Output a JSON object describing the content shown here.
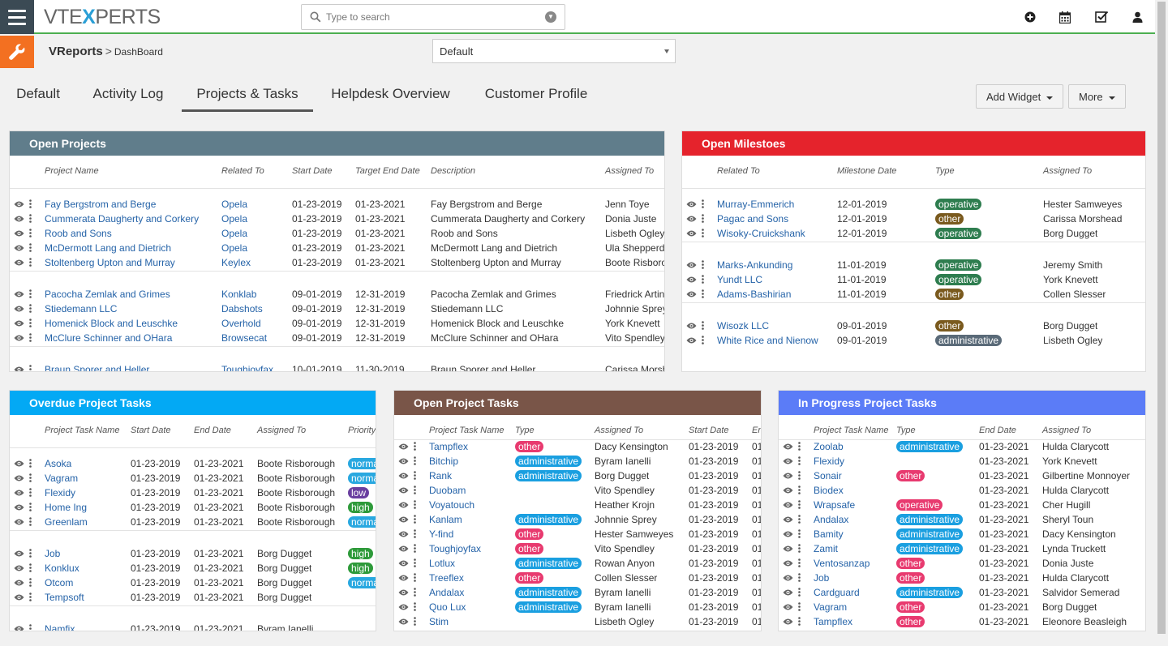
{
  "app": {
    "logo_left": "VTE",
    "logo_x": "X",
    "logo_right": "PERTS"
  },
  "search": {
    "placeholder": "Type to search"
  },
  "top_icons": [
    "plus-circle-icon",
    "calendar-icon",
    "checkbox-icon",
    "user-icon"
  ],
  "breadcrumb": {
    "main": "VReports",
    "sep": ">",
    "sub": "DashBoard"
  },
  "view_select": {
    "value": "Default"
  },
  "tabs": [
    {
      "label": "Default"
    },
    {
      "label": "Activity Log"
    },
    {
      "label": "Projects & Tasks"
    },
    {
      "label": "Helpdesk Overview"
    },
    {
      "label": "Customer Profile"
    }
  ],
  "buttons": {
    "add_widget": "Add Widget",
    "more": "More"
  },
  "colors": {
    "operative": "#2e7d4f",
    "other_brown": "#7a5a1e",
    "administrative_gray": "#5a6a78",
    "normal": "#29a8e0",
    "low": "#6a3fa0",
    "high": "#2e9a3a",
    "other_pink": "#e83a6f",
    "admin_blue": "#1a9fe0",
    "operative_pink": "#e83a6f"
  },
  "open_projects": {
    "title": "Open Projects",
    "columns": [
      "Project Name",
      "Related To",
      "Start Date",
      "Target End Date",
      "Description",
      "Assigned To"
    ],
    "groups": [
      [
        [
          "Fay Bergstrom and Berge",
          "Opela",
          "01-23-2019",
          "01-23-2021",
          "Fay Bergstrom and Berge",
          "Jenn Toye"
        ],
        [
          "Cummerata Daugherty and Corkery",
          "Opela",
          "01-23-2019",
          "01-23-2021",
          "Cummerata Daugherty and Corkery",
          "Donia Juste"
        ],
        [
          "Roob and Sons",
          "Opela",
          "01-23-2019",
          "01-23-2021",
          "Roob and Sons",
          "Lisbeth Ogley"
        ],
        [
          "McDermott Lang and Dietrich",
          "Opela",
          "01-23-2019",
          "01-23-2021",
          "McDermott Lang and Dietrich",
          "Ula Shepperd"
        ],
        [
          "Stoltenberg Upton and Murray",
          "Keylex",
          "01-23-2019",
          "01-23-2021",
          "Stoltenberg Upton and Murray",
          "Boote Risborough"
        ]
      ],
      [
        [
          "Pacocha Zemlak and Grimes",
          "Konklab",
          "09-01-2019",
          "12-31-2019",
          "Pacocha Zemlak and Grimes",
          "Friedrick Artin"
        ],
        [
          "Stiedemann LLC",
          "Dabshots",
          "09-01-2019",
          "12-31-2019",
          "Stiedemann LLC",
          "Johnnie Sprey"
        ],
        [
          "Homenick Block and Leuschke",
          "Overhold",
          "09-01-2019",
          "12-31-2019",
          "Homenick Block and Leuschke",
          "York Knevett"
        ],
        [
          "McClure Schinner and OHara",
          "Browsecat",
          "09-01-2019",
          "12-31-2019",
          "McClure Schinner and OHara",
          "Vito Spendley"
        ]
      ],
      [
        [
          "Braun Sporer and Heller",
          "Toughjoyfax",
          "10-01-2019",
          "11-30-2019",
          "Braun Sporer and Heller",
          "Carissa Morshead"
        ]
      ]
    ]
  },
  "open_milestones": {
    "title": "Open Milestoes",
    "columns": [
      "Related To",
      "Milestone Date",
      "Type",
      "Assigned To"
    ],
    "groups": [
      [
        [
          "Murray-Emmerich",
          "12-01-2019",
          "operative",
          "Hester Samweyes"
        ],
        [
          "Pagac and Sons",
          "12-01-2019",
          "other",
          "Carissa Morshead"
        ],
        [
          "Wisoky-Cruickshank",
          "12-01-2019",
          "operative",
          "Borg Dugget"
        ]
      ],
      [
        [
          "Marks-Ankunding",
          "11-01-2019",
          "operative",
          "Jeremy Smith"
        ],
        [
          "Yundt LLC",
          "11-01-2019",
          "operative",
          "York Knevett"
        ],
        [
          "Adams-Bashirian",
          "11-01-2019",
          "other",
          "Collen Slesser"
        ]
      ],
      [
        [
          "Wisozk LLC",
          "09-01-2019",
          "other",
          "Borg Dugget"
        ],
        [
          "White Rice and Nienow",
          "09-01-2019",
          "administrative",
          "Lisbeth Ogley"
        ]
      ]
    ]
  },
  "overdue_tasks": {
    "title": "Overdue Project Tasks",
    "columns": [
      "Project Task Name",
      "Start Date",
      "End Date",
      "Assigned To",
      "Priority"
    ],
    "groups": [
      [
        [
          "Asoka",
          "01-23-2019",
          "01-23-2021",
          "Boote Risborough",
          "normal"
        ],
        [
          "Vagram",
          "01-23-2019",
          "01-23-2021",
          "Boote Risborough",
          "normal"
        ],
        [
          "Flexidy",
          "01-23-2019",
          "01-23-2021",
          "Boote Risborough",
          "low"
        ],
        [
          "Home Ing",
          "01-23-2019",
          "01-23-2021",
          "Boote Risborough",
          "high"
        ],
        [
          "Greenlam",
          "01-23-2019",
          "01-23-2021",
          "Boote Risborough",
          "normal"
        ]
      ],
      [
        [
          "Job",
          "01-23-2019",
          "01-23-2021",
          "Borg Dugget",
          "high"
        ],
        [
          "Konklux",
          "01-23-2019",
          "01-23-2021",
          "Borg Dugget",
          "high"
        ],
        [
          "Otcom",
          "01-23-2019",
          "01-23-2021",
          "Borg Dugget",
          "normal"
        ],
        [
          "Tempsoft",
          "01-23-2019",
          "01-23-2021",
          "Borg Dugget",
          ""
        ]
      ],
      [
        [
          "Namfix",
          "01-23-2019",
          "01-23-2021",
          "Byram Ianelli",
          ""
        ]
      ]
    ]
  },
  "open_tasks": {
    "title": "Open Project Tasks",
    "columns": [
      "Project Task Name",
      "Type",
      "Assigned To",
      "Start Date",
      "End Date"
    ],
    "rows": [
      [
        "Tampflex",
        "other",
        "Dacy Kensington",
        "01-23-2019",
        "01"
      ],
      [
        "Bitchip",
        "administrative",
        "Byram Ianelli",
        "01-23-2019",
        "01"
      ],
      [
        "Rank",
        "administrative",
        "Borg Dugget",
        "01-23-2019",
        "01"
      ],
      [
        "Duobam",
        "",
        "Vito Spendley",
        "01-23-2019",
        "01"
      ],
      [
        "Voyatouch",
        "",
        "Heather Krojn",
        "01-23-2019",
        "01"
      ],
      [
        "Kanlam",
        "administrative",
        "Johnnie Sprey",
        "01-23-2019",
        "01"
      ],
      [
        "Y-find",
        "other",
        "Hester Samweyes",
        "01-23-2019",
        "01"
      ],
      [
        "Toughjoyfax",
        "other",
        "Vito Spendley",
        "01-23-2019",
        "01"
      ],
      [
        "Lotlux",
        "administrative",
        "Rowan Anyon",
        "01-23-2019",
        "01"
      ],
      [
        "Treeflex",
        "other",
        "Collen Slesser",
        "01-23-2019",
        "01"
      ],
      [
        "Andalax",
        "administrative",
        "Byram Ianelli",
        "01-23-2019",
        "01"
      ],
      [
        "Quo Lux",
        "administrative",
        "Byram Ianelli",
        "01-23-2019",
        "01"
      ],
      [
        "Stim",
        "",
        "Lisbeth Ogley",
        "01-23-2019",
        "01"
      ]
    ]
  },
  "inprogress_tasks": {
    "title": "In Progress Project Tasks",
    "columns": [
      "Project Task Name",
      "Type",
      "End Date",
      "Assigned To"
    ],
    "rows": [
      [
        "Zoolab",
        "administrative",
        "01-23-2021",
        "Hulda Clarycott"
      ],
      [
        "Flexidy",
        "",
        "01-23-2021",
        "York Knevett"
      ],
      [
        "Sonair",
        "other",
        "01-23-2021",
        "Gilbertine Monnoyer"
      ],
      [
        "Biodex",
        "",
        "01-23-2021",
        "Hulda Clarycott"
      ],
      [
        "Wrapsafe",
        "operative",
        "01-23-2021",
        "Cher Hugill"
      ],
      [
        "Andalax",
        "administrative",
        "01-23-2021",
        "Sheryl Toun"
      ],
      [
        "Bamity",
        "administrative",
        "01-23-2021",
        "Dacy Kensington"
      ],
      [
        "Zamit",
        "administrative",
        "01-23-2021",
        "Lynda Truckett"
      ],
      [
        "Ventosanzap",
        "other",
        "01-23-2021",
        "Donia Juste"
      ],
      [
        "Job",
        "other",
        "01-23-2021",
        "Hulda Clarycott"
      ],
      [
        "Cardguard",
        "administrative",
        "01-23-2021",
        "Salvidor Semerad"
      ],
      [
        "Vagram",
        "other",
        "01-23-2021",
        "Borg Dugget"
      ],
      [
        "Tampflex",
        "other",
        "01-23-2021",
        "Eleonore Beasleigh"
      ]
    ]
  }
}
